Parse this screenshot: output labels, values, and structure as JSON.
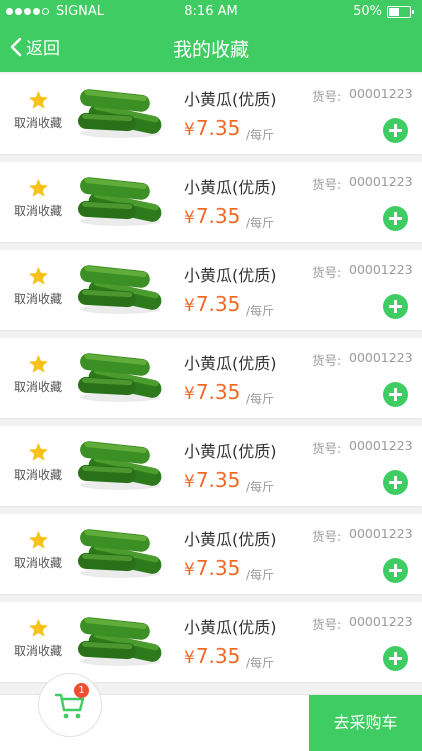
{
  "status_bar": {
    "carrier": "SIGNAL",
    "time": "8:16 AM",
    "battery": "50%",
    "battery_level": 0.5
  },
  "header": {
    "back_label": "返回",
    "title": "我的收藏"
  },
  "items": [
    {
      "fav_label": "取消收藏",
      "name": "小黄瓜(优质)",
      "code_label": "货号:",
      "code": "00001223",
      "currency": "¥",
      "price": "7.35",
      "unit": "/每斤"
    },
    {
      "fav_label": "取消收藏",
      "name": "小黄瓜(优质)",
      "code_label": "货号:",
      "code": "00001223",
      "currency": "¥",
      "price": "7.35",
      "unit": "/每斤"
    },
    {
      "fav_label": "取消收藏",
      "name": "小黄瓜(优质)",
      "code_label": "货号:",
      "code": "00001223",
      "currency": "¥",
      "price": "7.35",
      "unit": "/每斤"
    },
    {
      "fav_label": "取消收藏",
      "name": "小黄瓜(优质)",
      "code_label": "货号:",
      "code": "00001223",
      "currency": "¥",
      "price": "7.35",
      "unit": "/每斤"
    },
    {
      "fav_label": "取消收藏",
      "name": "小黄瓜(优质)",
      "code_label": "货号:",
      "code": "00001223",
      "currency": "¥",
      "price": "7.35",
      "unit": "/每斤"
    },
    {
      "fav_label": "取消收藏",
      "name": "小黄瓜(优质)",
      "code_label": "货号:",
      "code": "00001223",
      "currency": "¥",
      "price": "7.35",
      "unit": "/每斤"
    },
    {
      "fav_label": "取消收藏",
      "name": "小黄瓜(优质)",
      "code_label": "货号:",
      "code": "00001223",
      "currency": "¥",
      "price": "7.35",
      "unit": "/每斤"
    }
  ],
  "cart": {
    "badge_count": "1",
    "checkout_label": "去采购车"
  },
  "colors": {
    "brand_green": "#3fcc62",
    "price_orange": "#f06a25",
    "star_yellow": "#f7c31b",
    "badge_red": "#f04e31"
  },
  "icons": {
    "back": "chevron-left-icon",
    "favorite": "star-icon",
    "add": "plus-circle-icon",
    "cart": "shopping-cart-icon"
  }
}
